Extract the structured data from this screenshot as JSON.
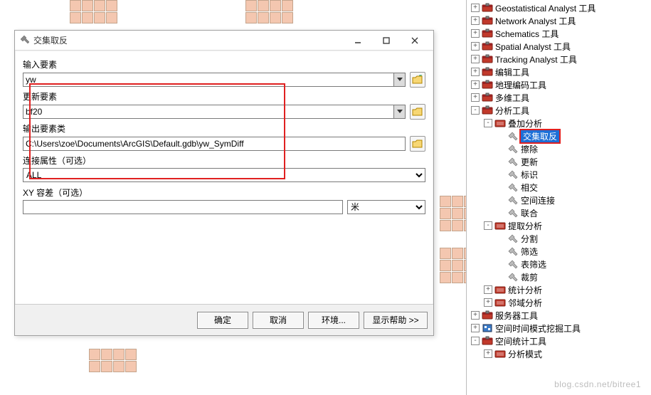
{
  "dialog": {
    "title": "交集取反",
    "labels": {
      "input_features": "输入要素",
      "update_features": "更新要素",
      "output_fc": "输出要素类",
      "join_attr": "连接属性（可选）",
      "xy_tol": "XY 容差（可选）"
    },
    "values": {
      "input_features": "yw",
      "update_features": "bf20",
      "output_fc": "C:\\Users\\zoe\\Documents\\ArcGIS\\Default.gdb\\yw_SymDiff",
      "join_attr": "ALL",
      "xy_tol": "",
      "xy_tol_unit": "米"
    },
    "buttons": {
      "ok": "确定",
      "cancel": "取消",
      "env": "环境...",
      "help": "显示帮助 >>"
    }
  },
  "tree": [
    {
      "d": 0,
      "e": "+",
      "i": "tb",
      "t": "Geostatistical Analyst 工具"
    },
    {
      "d": 0,
      "e": "+",
      "i": "tb",
      "t": "Network Analyst 工具"
    },
    {
      "d": 0,
      "e": "+",
      "i": "tb",
      "t": "Schematics 工具"
    },
    {
      "d": 0,
      "e": "+",
      "i": "tb",
      "t": "Spatial Analyst 工具"
    },
    {
      "d": 0,
      "e": "+",
      "i": "tb",
      "t": "Tracking Analyst 工具"
    },
    {
      "d": 0,
      "e": "+",
      "i": "tb",
      "t": "编辑工具"
    },
    {
      "d": 0,
      "e": "+",
      "i": "tb",
      "t": "地理编码工具"
    },
    {
      "d": 0,
      "e": "+",
      "i": "tb",
      "t": "多维工具"
    },
    {
      "d": 0,
      "e": "-",
      "i": "tb",
      "t": "分析工具"
    },
    {
      "d": 1,
      "e": "-",
      "i": "ts",
      "t": "叠加分析"
    },
    {
      "d": 2,
      "e": " ",
      "i": "tl",
      "t": "交集取反",
      "sel": true
    },
    {
      "d": 2,
      "e": " ",
      "i": "tl",
      "t": "擦除"
    },
    {
      "d": 2,
      "e": " ",
      "i": "tl",
      "t": "更新"
    },
    {
      "d": 2,
      "e": " ",
      "i": "tl",
      "t": "标识"
    },
    {
      "d": 2,
      "e": " ",
      "i": "tl",
      "t": "相交"
    },
    {
      "d": 2,
      "e": " ",
      "i": "tl",
      "t": "空间连接"
    },
    {
      "d": 2,
      "e": " ",
      "i": "tl",
      "t": "联合"
    },
    {
      "d": 1,
      "e": "-",
      "i": "ts",
      "t": "提取分析"
    },
    {
      "d": 2,
      "e": " ",
      "i": "tl",
      "t": "分割"
    },
    {
      "d": 2,
      "e": " ",
      "i": "tl",
      "t": "筛选"
    },
    {
      "d": 2,
      "e": " ",
      "i": "tl",
      "t": "表筛选"
    },
    {
      "d": 2,
      "e": " ",
      "i": "tl",
      "t": "裁剪"
    },
    {
      "d": 1,
      "e": "+",
      "i": "ts",
      "t": "统计分析"
    },
    {
      "d": 1,
      "e": "+",
      "i": "ts",
      "t": "邻域分析"
    },
    {
      "d": 0,
      "e": "+",
      "i": "tb",
      "t": "服务器工具"
    },
    {
      "d": 0,
      "e": "+",
      "i": "sp",
      "t": "空间时间模式挖掘工具"
    },
    {
      "d": 0,
      "e": "-",
      "i": "tb",
      "t": "空间统计工具"
    },
    {
      "d": 1,
      "e": "+",
      "i": "ts",
      "t": "分析模式"
    }
  ],
  "watermark": "blog.csdn.net/bitree1"
}
